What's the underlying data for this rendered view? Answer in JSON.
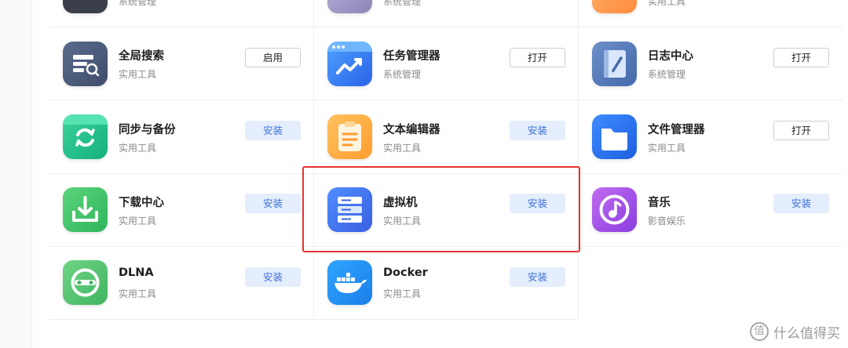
{
  "top_row": [
    {
      "category": "系统管理"
    },
    {
      "category": "系统管理"
    },
    {
      "category": "实用工具"
    }
  ],
  "apps": [
    {
      "name": "全局搜索",
      "category": "实用工具",
      "button": "启用",
      "icon": "search-list-icon"
    },
    {
      "name": "任务管理器",
      "category": "系统管理",
      "button": "打开",
      "icon": "chart-window-icon"
    },
    {
      "name": "日志中心",
      "category": "系统管理",
      "button": "打开",
      "icon": "notebook-pen-icon"
    },
    {
      "name": "同步与备份",
      "category": "实用工具",
      "button": "安装",
      "icon": "sync-folder-icon"
    },
    {
      "name": "文本编辑器",
      "category": "实用工具",
      "button": "安装",
      "icon": "clipboard-text-icon"
    },
    {
      "name": "文件管理器",
      "category": "实用工具",
      "button": "打开",
      "icon": "folder-icon"
    },
    {
      "name": "下载中心",
      "category": "实用工具",
      "button": "安装",
      "icon": "download-tray-icon"
    },
    {
      "name": "虚拟机",
      "category": "实用工具",
      "button": "安装",
      "icon": "server-rack-icon"
    },
    {
      "name": "音乐",
      "category": "影音娱乐",
      "button": "安装",
      "icon": "music-note-icon"
    },
    {
      "name": "DLNA",
      "category": "实用工具",
      "button": "安装",
      "icon": "dlna-icon"
    },
    {
      "name": "Docker",
      "category": "实用工具",
      "button": "安装",
      "icon": "docker-whale-icon"
    }
  ],
  "watermark": {
    "text": "什么值得买",
    "badge": "值"
  },
  "colors": {
    "install_bg": "#e5eefc",
    "install_text": "#3a6fd8",
    "highlight": "#e8322f"
  }
}
